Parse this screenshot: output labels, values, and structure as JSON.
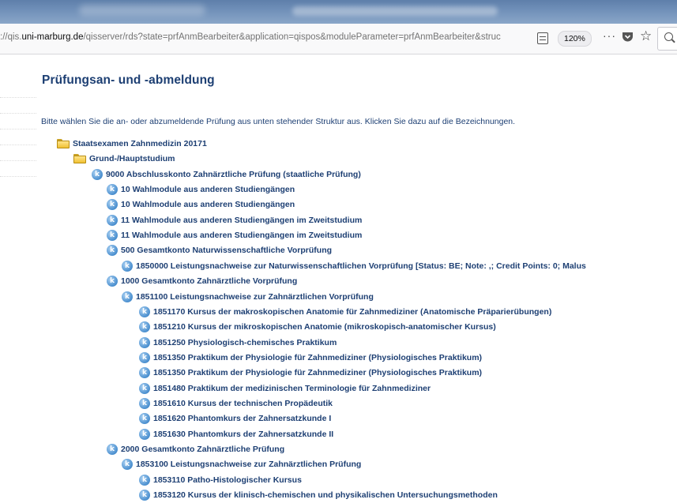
{
  "browser": {
    "url_prefix": "://qis.",
    "url_domain": "uni-marburg.de",
    "url_rest": "/qisserver/rds?state=prfAnmBearbeiter&application=qispos&moduleParameter=prfAnmBearbeiter&struc",
    "zoom": "120%",
    "more_label": "···"
  },
  "page": {
    "title": "Prüfungsan- und -abmeldung",
    "instruction": "Bitte wählen Sie die an- oder abzumeldende Prüfung aus unten stehender Struktur aus. Klicken Sie dazu auf die Bezeichnungen."
  },
  "tree": [
    {
      "icon": "folder",
      "level": 0,
      "label": "Staatsexamen Zahnmedizin 20171"
    },
    {
      "icon": "folder",
      "level": 1,
      "label": "Grund-/Hauptstudium"
    },
    {
      "icon": "k",
      "level": 2,
      "label": "9000 Abschlusskonto Zahnärztliche Prüfung (staatliche Prüfung)"
    },
    {
      "icon": "k",
      "level": 3,
      "label": "10 Wahlmodule aus anderen Studiengängen"
    },
    {
      "icon": "k",
      "level": 3,
      "label": "10 Wahlmodule aus anderen Studiengängen"
    },
    {
      "icon": "k",
      "level": 3,
      "label": "11 Wahlmodule aus anderen Studiengängen im Zweitstudium"
    },
    {
      "icon": "k",
      "level": 3,
      "label": "11 Wahlmodule aus anderen Studiengängen im Zweitstudium"
    },
    {
      "icon": "k",
      "level": 3,
      "label": "500 Gesamtkonto Naturwissenschaftliche Vorprüfung"
    },
    {
      "icon": "k",
      "level": 4,
      "label": "1850000 Leistungsnachweise zur Naturwissenschaftlichen Vorprüfung [Status: BE; Note: ,; Credit Points: 0; Malus"
    },
    {
      "icon": "k",
      "level": 3,
      "label": "1000 Gesamtkonto Zahnärztliche Vorprüfung"
    },
    {
      "icon": "k",
      "level": 4,
      "label": "1851100 Leistungsnachweise zur Zahnärztlichen Vorprüfung"
    },
    {
      "icon": "k",
      "level": 5,
      "label": "1851170 Kursus der makroskopischen Anatomie für Zahnmediziner (Anatomische Präparierübungen)"
    },
    {
      "icon": "k",
      "level": 5,
      "label": "1851210 Kursus der mikroskopischen Anatomie (mikroskopisch-anatomischer Kursus)"
    },
    {
      "icon": "k",
      "level": 5,
      "label": "1851250 Physiologisch-chemisches Praktikum"
    },
    {
      "icon": "k",
      "level": 5,
      "label": "1851350 Praktikum der Physiologie für Zahnmediziner (Physiologisches Praktikum)"
    },
    {
      "icon": "k",
      "level": 5,
      "label": "1851350 Praktikum der Physiologie für Zahnmediziner (Physiologisches Praktikum)"
    },
    {
      "icon": "k",
      "level": 5,
      "label": "1851480 Praktikum der medizinischen Terminologie für Zahnmediziner"
    },
    {
      "icon": "k",
      "level": 5,
      "label": "1851610 Kursus der technischen Propädeutik"
    },
    {
      "icon": "k",
      "level": 5,
      "label": "1851620 Phantomkurs der Zahnersatzkunde I"
    },
    {
      "icon": "k",
      "level": 5,
      "label": "1851630 Phantomkurs der Zahnersatzkunde II"
    },
    {
      "icon": "k",
      "level": 3,
      "label": "2000 Gesamtkonto Zahnärztliche Prüfung"
    },
    {
      "icon": "k",
      "level": 4,
      "label": "1853100 Leistungsnachweise zur Zahnärztlichen Prüfung"
    },
    {
      "icon": "k",
      "level": 5,
      "label": "1853110 Patho-Histologischer Kursus"
    },
    {
      "icon": "k",
      "level": 5,
      "label": "1853120 Kursus der klinisch-chemischen und physikalischen Untersuchungsmethoden"
    }
  ]
}
